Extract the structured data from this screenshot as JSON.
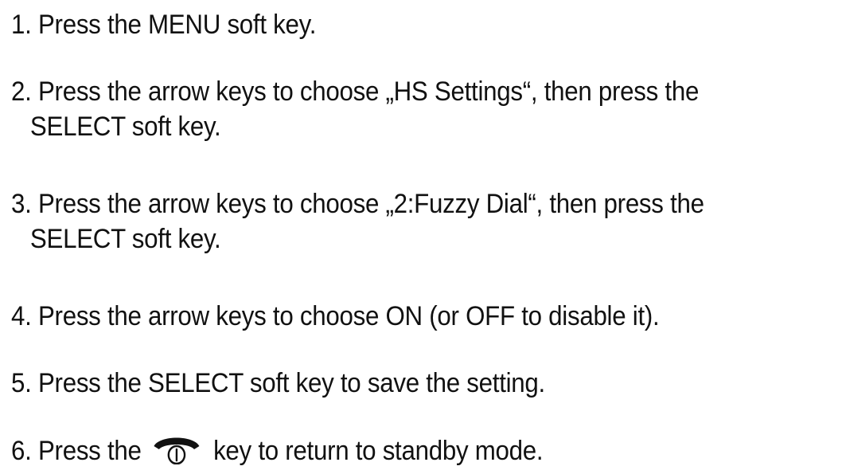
{
  "steps": [
    {
      "number": "1.",
      "text": "Press the MENU soft key."
    },
    {
      "number": "2.",
      "line1": "Press the arrow keys to choose „HS Settings“, then press the",
      "line2": "SELECT soft key."
    },
    {
      "number": "3.",
      "line1": "Press the arrow keys to choose „2:Fuzzy Dial“, then press the",
      "line2": "SELECT soft key."
    },
    {
      "number": "4.",
      "text": "Press the arrow keys to choose ON (or OFF to disable it)."
    },
    {
      "number": "5.",
      "text": "Press the SELECT soft key to save the setting."
    },
    {
      "number": "6.",
      "before_icon": "Press the",
      "after_icon": "key to return to standby mode.",
      "icon": "end-call-power-key-icon"
    }
  ],
  "colors": {
    "text": "#111111",
    "background": "#ffffff"
  }
}
